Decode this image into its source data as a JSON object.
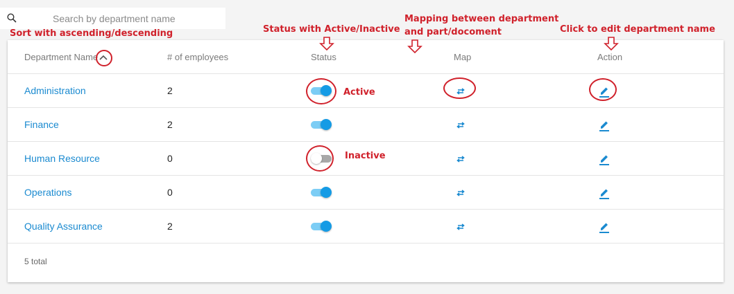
{
  "search": {
    "placeholder": "Search by department name"
  },
  "table": {
    "headers": {
      "name": "Department Name",
      "employees": "# of employees",
      "status": "Status",
      "map": "Map",
      "action": "Action"
    },
    "rows": [
      {
        "name": "Administration",
        "employees": "2",
        "active": true
      },
      {
        "name": "Finance",
        "employees": "2",
        "active": true
      },
      {
        "name": "Human Resource",
        "employees": "0",
        "active": false
      },
      {
        "name": "Operations",
        "employees": "0",
        "active": true
      },
      {
        "name": "Quality Assurance",
        "employees": "2",
        "active": true
      }
    ],
    "footer": "5 total"
  },
  "annotations": {
    "sort": "Sort with ascending/descending",
    "status": "Status with Active/Inactive",
    "map_line1": "Mapping between department",
    "map_line2": "and part/docoment",
    "action": "Click to edit department name",
    "active": "Active",
    "inactive": "Inactive"
  },
  "colors": {
    "accent": "#159be5",
    "link": "#1a8ad0",
    "annotation": "#d0212b"
  },
  "icons": {
    "search": "search-icon",
    "sort": "chevron-up-icon",
    "map": "swap-arrows-icon",
    "edit": "pencil-icon"
  }
}
